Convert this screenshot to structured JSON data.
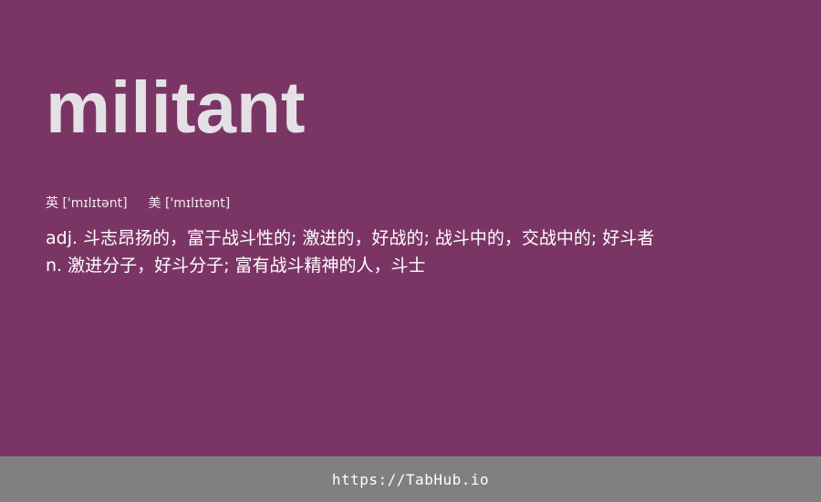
{
  "entry": {
    "word": "militant",
    "phonetics": {
      "uk_label": "英",
      "uk_ipa": "['mɪlɪtənt]",
      "us_label": "美",
      "us_ipa": "['mɪlɪtənt]"
    },
    "definitions": [
      {
        "pos": "adj.",
        "text": "斗志昂扬的，富于战斗性的; 激进的，好战的; 战斗中的，交战中的; 好斗者"
      },
      {
        "pos": "n.",
        "text": "激进分子，好斗分子; 富有战斗精神的人，斗士"
      }
    ]
  },
  "footer": {
    "link_text": "https://TabHub.io"
  },
  "colors": {
    "background": "#7b3565",
    "word": "#e4e1e6",
    "footer_bar": "#808080",
    "text": "#ffffff"
  }
}
